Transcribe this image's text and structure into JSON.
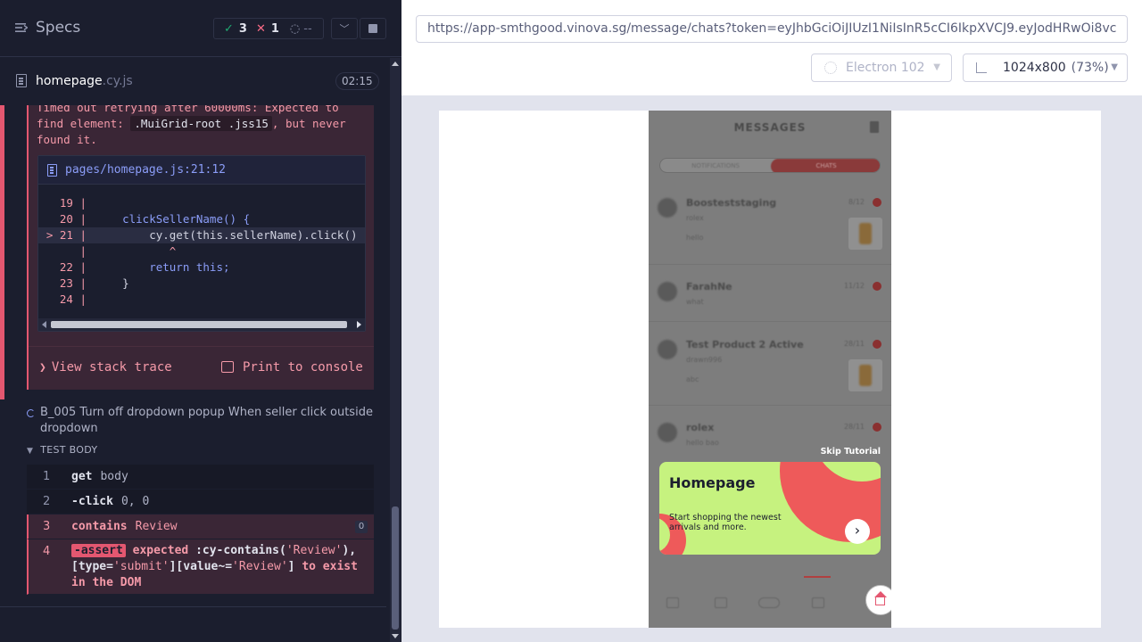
{
  "reporter": {
    "header": {
      "specs_label": "Specs",
      "passed_count": "3",
      "failed_count": "1",
      "pending_count": "--"
    },
    "spec": {
      "file_name": "homepage",
      "file_ext": ".cy.js",
      "duration": "02:15"
    },
    "error": {
      "message_prefix": "Timed out retrying after 60000ms: Expected to find element:",
      "selector": ".MuiGrid-root .jss15",
      "message_suffix": ", but never found it.",
      "codeframe_file": "pages/homepage.js:21:12",
      "code_lines": [
        {
          "num": "19",
          "prefix": "",
          "code": ""
        },
        {
          "num": "20",
          "prefix": "",
          "code": "    clickSellerName() {"
        },
        {
          "num": "21",
          "prefix": "> ",
          "code": "        cy.get(this.sellerName).click()"
        },
        {
          "num": "",
          "prefix": "",
          "code": "           ^"
        },
        {
          "num": "22",
          "prefix": "",
          "code": "        return this;"
        },
        {
          "num": "23",
          "prefix": "",
          "code": "    }"
        },
        {
          "num": "24",
          "prefix": "",
          "code": ""
        }
      ],
      "view_stack_trace": "View stack trace",
      "print_to_console": "Print to console"
    },
    "test": {
      "title": "B_005 Turn off dropdown popup When seller click outside dropdown",
      "body_label": "TEST BODY",
      "commands": [
        {
          "num": "1",
          "name": "get",
          "arg": "body"
        },
        {
          "num": "2",
          "name": "-click",
          "arg": "0, 0"
        },
        {
          "num": "3",
          "name": "contains",
          "arg": "Review",
          "badge": "0"
        },
        {
          "num": "4",
          "name": "-assert",
          "assert_text_1": "expected",
          "assert_text_2": ":cy-contains(",
          "q1": "'Review'",
          "assert_text_3": "),",
          "assert_line2_1": "[type=",
          "q2": "'submit'",
          "assert_line2_2": "][value~=",
          "q3": "'Review'",
          "assert_line2_3": "]",
          "assert_tail": "to exist in the DOM"
        }
      ]
    }
  },
  "aut": {
    "url": "https://app-smthgood.vinova.sg/message/chats?token=eyJhbGciOiJIUzI1NiIsInR5cCI6IkpXVCJ9.eyJodHRwOi8vc",
    "browser": "Electron 102",
    "viewport": "1024x800",
    "zoom": "(73%)",
    "app": {
      "title": "MESSAGES",
      "tabs": [
        "NOTIFICATIONS",
        "CHATS"
      ],
      "chats": [
        {
          "name": "Boosteststaging",
          "sub": "rolex",
          "msg": "hello",
          "date": "8/12",
          "has_thumb": true
        },
        {
          "name": "FarahNe",
          "sub": "what",
          "msg": "",
          "date": "11/12",
          "has_thumb": false
        },
        {
          "name": "Test Product 2 Active",
          "sub": "drawn996",
          "msg": "abc",
          "date": "28/11",
          "has_thumb": true
        },
        {
          "name": "rolex",
          "sub": "hello bao",
          "msg": "",
          "date": "28/11",
          "has_thumb": false
        }
      ],
      "skip_tutorial": "Skip Tutorial",
      "tutorial_card": {
        "title": "Homepage",
        "text": "Start shopping the newest arrivals and more."
      }
    }
  }
}
